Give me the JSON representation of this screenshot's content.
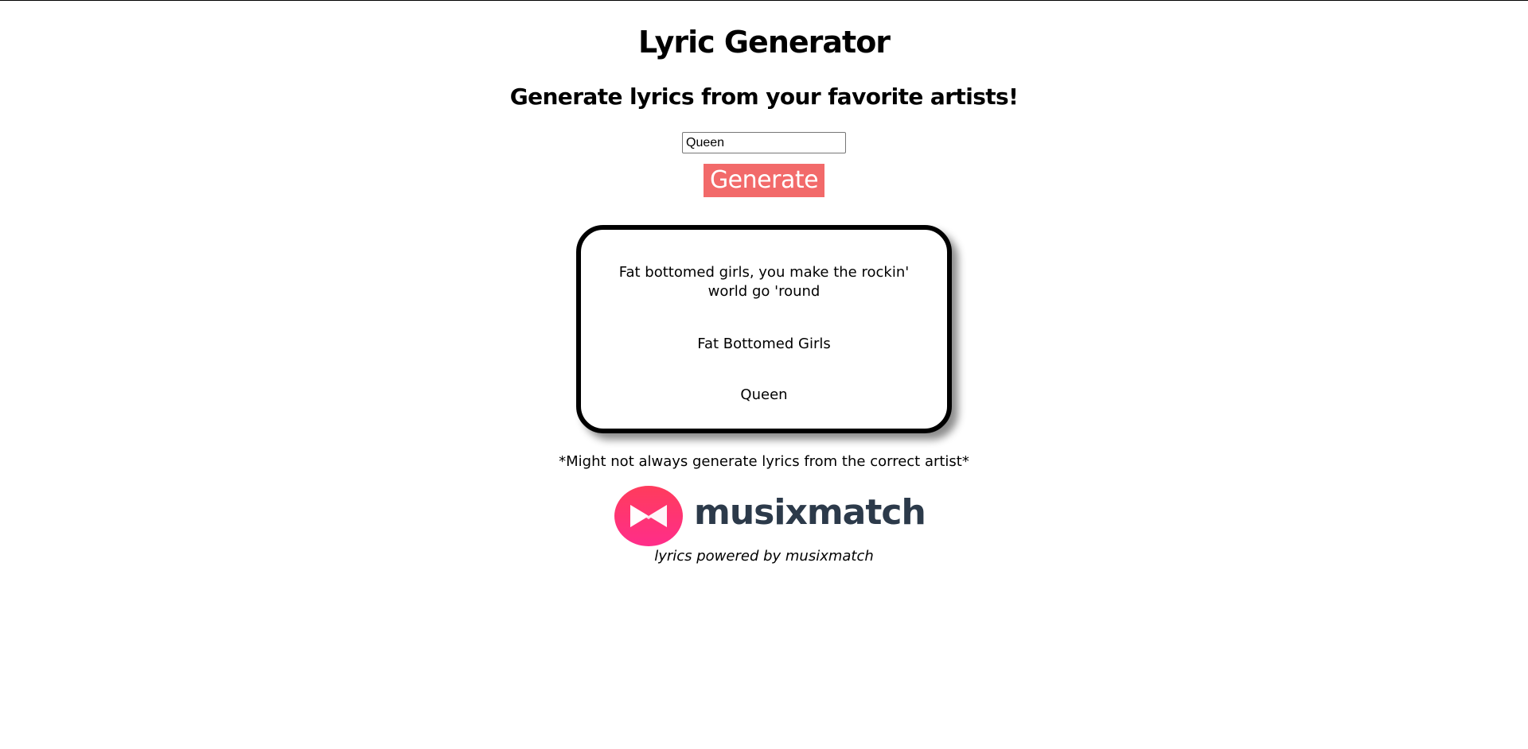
{
  "header": {
    "title": "Lyric Generator",
    "subtitle": "Generate lyrics from your favorite artists!"
  },
  "search": {
    "value": "Queen",
    "button_label": "Generate"
  },
  "result": {
    "lyric": "Fat bottomed girls, you make the rockin' world go 'round",
    "track": "Fat Bottomed Girls",
    "artist": "Queen"
  },
  "footer": {
    "disclaimer": "*Might not always generate lyrics from the correct artist*",
    "logo_text": "musixmatch",
    "powered_by": "lyrics powered by musixmatch"
  },
  "colors": {
    "button": "#f26a6a",
    "logo_gradient_top": "#ff3c5c",
    "logo_gradient_bottom": "#ff2d8a",
    "logo_text": "#2c3a4a"
  },
  "icons": {
    "logo": "musixmatch-logo-icon"
  }
}
